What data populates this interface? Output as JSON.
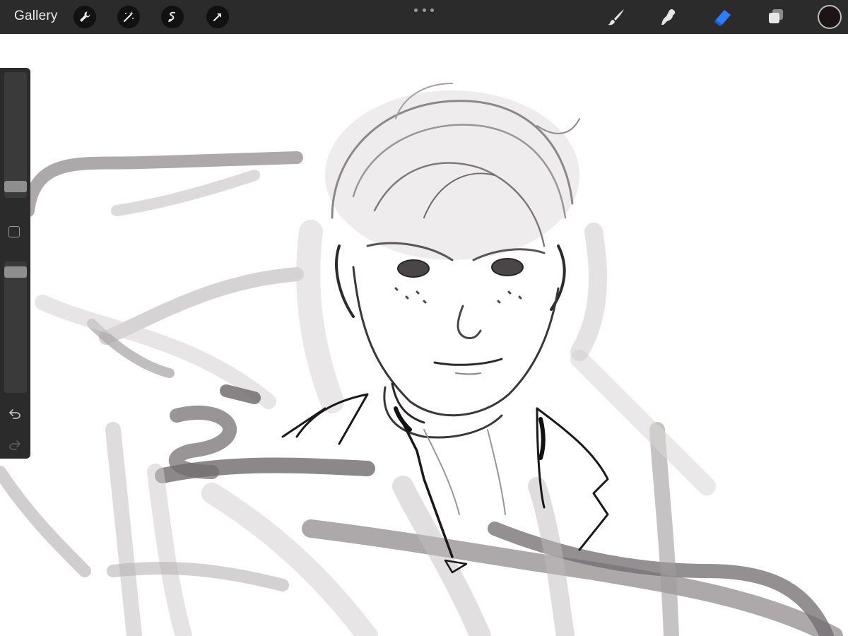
{
  "topbar": {
    "gallery_label": "Gallery",
    "left_tools": [
      "wrench-icon",
      "magic-wand-icon",
      "selection-icon",
      "transform-arrow-icon"
    ],
    "more_menu": "ellipsis-icon",
    "right_tools": [
      "brush-icon",
      "smudge-icon",
      "eraser-icon",
      "layers-icon"
    ],
    "active_tool": "eraser-icon",
    "active_tool_color": "#2f7dff",
    "current_color": "#1e1416"
  },
  "sidebar": {
    "brush_size": 0.4,
    "brush_opacity": 1.0,
    "buttons": [
      "modify-square",
      "undo-icon",
      "redo-icon"
    ]
  },
  "canvas": {
    "background": "#ffffff",
    "subject": "sketch-portrait"
  }
}
